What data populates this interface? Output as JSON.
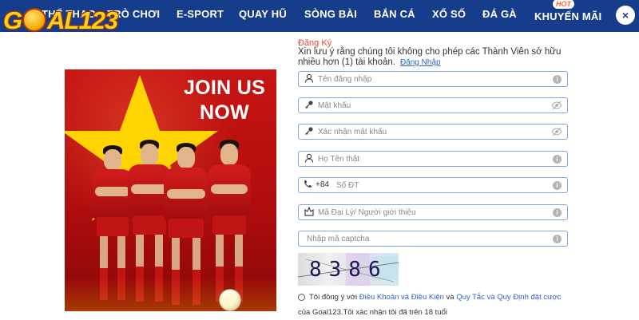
{
  "nav": {
    "items": [
      "THỂ THAO",
      "TRÒ CHƠI",
      "E-SPORT",
      "QUAY HŨ",
      "SÒNG BÀI",
      "BẮN CÁ",
      "XỔ SỐ",
      "ĐÁ GÀ",
      "KHUYẾN MÃI"
    ],
    "hot_badge": "HOT",
    "close": "×"
  },
  "logo": {
    "text_left": "G",
    "text_right": "AL123"
  },
  "banner": {
    "line1": "JOIN US",
    "line2": "NOW"
  },
  "form": {
    "title": "Đăng Ký",
    "note": "Xin lưu ý rằng chúng tôi không cho phép các Thành Viên sở hữu nhiều hơn (1) tài khoản.",
    "login_link": "Đăng Nhập",
    "fields": {
      "username": {
        "placeholder": "Tên đăng nhập"
      },
      "password": {
        "placeholder": "Mật khẩu"
      },
      "confirm_password": {
        "placeholder": "Xác nhận mật khẩu"
      },
      "full_name": {
        "placeholder": "Họ Tên thật"
      },
      "phone": {
        "prefix": "+84",
        "placeholder": "Số ĐT"
      },
      "agent": {
        "placeholder": "Mã Đại Lý/ Người giới thiệu"
      },
      "captcha": {
        "placeholder": "Nhập mã captcha"
      }
    },
    "captcha_code": "8386",
    "terms": {
      "prefix": "Tôi đồng ý với",
      "link1": "Điều Khoản và Điều Kiện",
      "and": "và",
      "link2": "Quy Tắc và Quy Định đặt cược",
      "suffix": "của Goal123.Tôi xác nhận tôi đã trên 18 tuổi"
    }
  },
  "colors": {
    "nav_bg": "#163d8c",
    "accent": "#e8462a",
    "link": "#2a62c8",
    "field_border": "#7fa7e0"
  },
  "icons": [
    "user-icon",
    "key-icon",
    "key-icon",
    "user-icon",
    "phone-icon",
    "agent-icon",
    "info-icon",
    "eye-off-icon",
    "close-icon"
  ]
}
